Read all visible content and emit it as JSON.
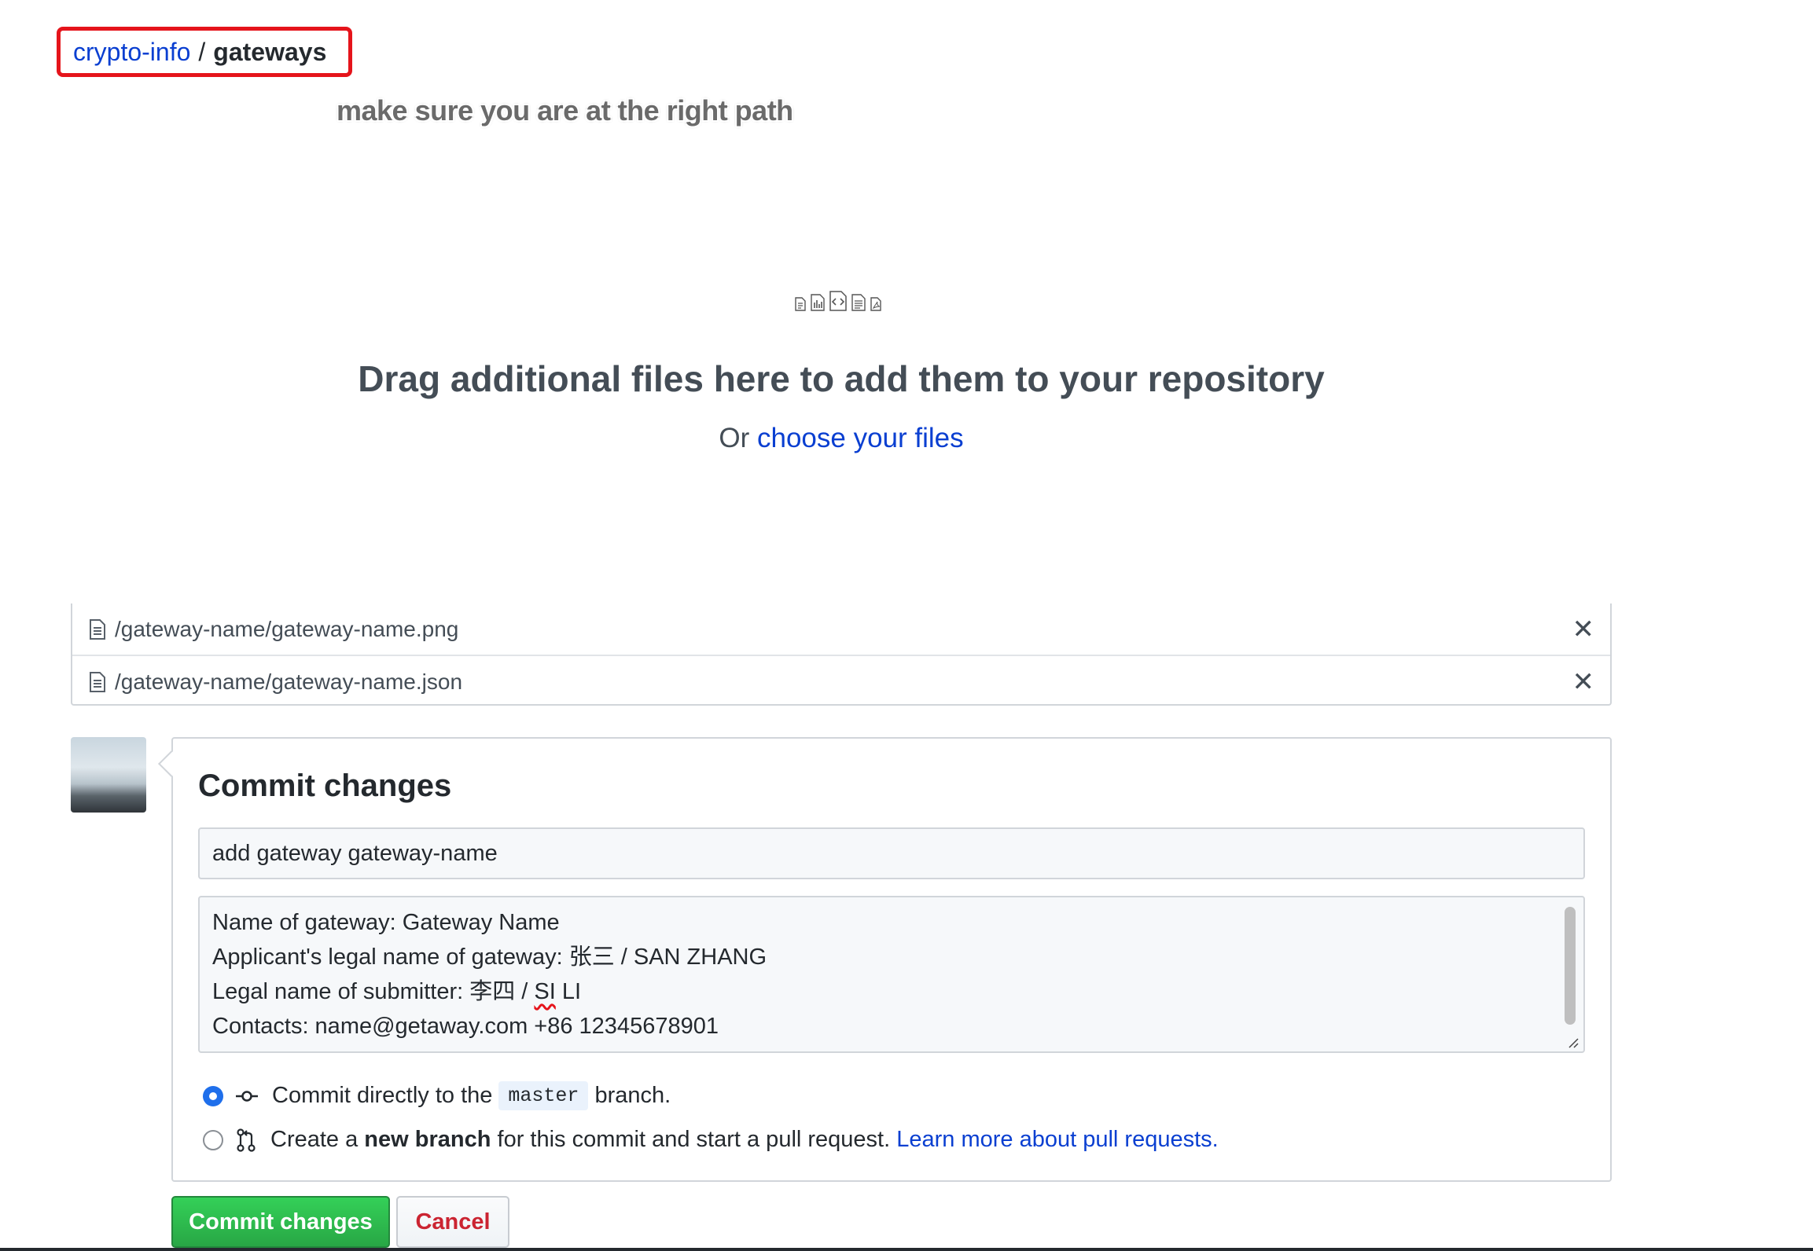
{
  "breadcrumb": {
    "repo": "crypto-info",
    "separator": "/",
    "folder": "gateways"
  },
  "annotation": "make sure you are at the right path",
  "dropzone": {
    "title": "Drag additional files here to add them to your repository",
    "prefix": "Or",
    "link": "choose your files"
  },
  "files": [
    {
      "name": "/gateway-name/gateway-name.png",
      "remove": "✕"
    },
    {
      "name": "/gateway-name/gateway-name.json",
      "remove": "✕"
    }
  ],
  "commit": {
    "heading": "Commit changes",
    "summary": "add gateway gateway-name",
    "description_lines": [
      "Name of gateway: Gateway Name",
      "Applicant's legal name of gateway: 张三 / SAN ZHANG",
      "Legal name of submitter: 李四 / ",
      "SI",
      " LI",
      "Contacts: name@getaway.com  +86 12345678901"
    ],
    "option_direct": {
      "prefix": "Commit directly to the",
      "branch": "master",
      "suffix": "branch."
    },
    "option_new": {
      "prefix": "Create a",
      "bold": "new branch",
      "suffix": "for this commit and start a pull request.",
      "link": "Learn more about pull requests."
    },
    "submit_label": "Commit changes",
    "cancel_label": "Cancel"
  },
  "colors": {
    "link": "#0a3fd1",
    "highlight_border": "#e5141b",
    "primary": "#28a745",
    "danger": "#cb2431",
    "radio_active": "#1f6feb"
  }
}
